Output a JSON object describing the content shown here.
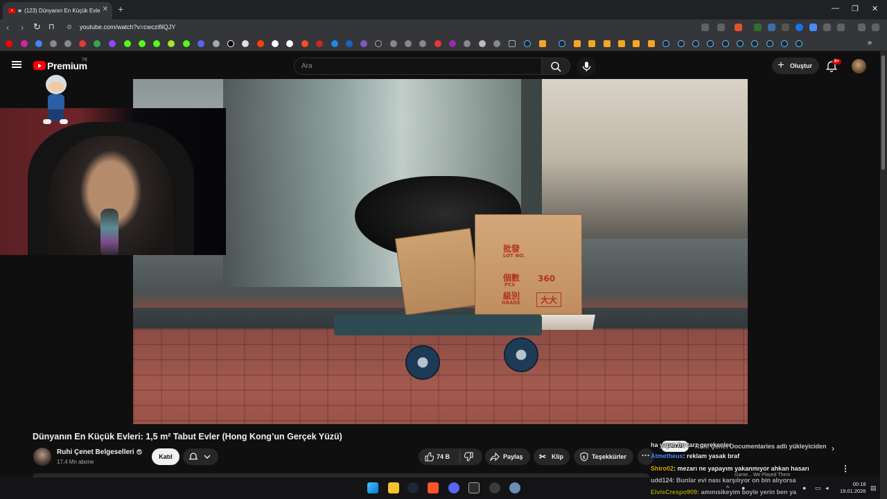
{
  "browser": {
    "tab_title": "(123) Dünyanın En Küçük Evle",
    "new_tab": "+",
    "url": "youtube.com/watch?v=cwczifilQJY"
  },
  "youtube": {
    "logo_text": "Premium",
    "region": "TR",
    "search_placeholder": "Ara",
    "create_label": "Oluştur",
    "notif_badge": "9+"
  },
  "video": {
    "box_texts": [
      "批發",
      "LOT NO.",
      "360",
      "個數",
      "PCS",
      "級別",
      "GRADE",
      "大大"
    ],
    "title": "Dünyanın En Küçük Evleri: 1,5 m² Tabut Evler (Hong Kong’un Gerçek Yüzü)"
  },
  "channel": {
    "name": "Ruhi Çenet Belgeselleri",
    "subscribers": "17,4 Mn abone",
    "join_label": "Katıl"
  },
  "actions": {
    "likes": "74 B",
    "share": "Paylaş",
    "clip": "Klip",
    "thanks": "Teşekkürler",
    "more": "···"
  },
  "recommendations": {
    "chip_all": "Tümü",
    "chip_channel": "Ruhi Çenet Documentaries adlı yükleyiciden",
    "rec_title": "Game... We Played Them"
  },
  "chat": [
    {
      "user": "",
      "text": "ha yapın bu tarz gerekenler",
      "color": "#e0e0e0"
    },
    {
      "user": "Atmetheus",
      "text": ": reklam yasak braf",
      "color": "#4f8cff"
    },
    {
      "user": "Shiro02",
      "text": ": mezarı ne yapayım yakanmıyor ahkan hasarı",
      "color": "#e0a800"
    },
    {
      "user": "udd124",
      "text": ": Bunlar evi nası karşılıyor on bin alıyorsa",
      "color": "#ffffff"
    },
    {
      "user": "ElvisCrespo909",
      "text": ": amınısikeyim boyle yerin ben ya",
      "color": "#e3d400"
    }
  ],
  "taskbar": {
    "time": "00:18",
    "date": "19.01.2026"
  },
  "colors": {
    "accent_red": "#ff0000",
    "background": "#0f0f0f"
  }
}
